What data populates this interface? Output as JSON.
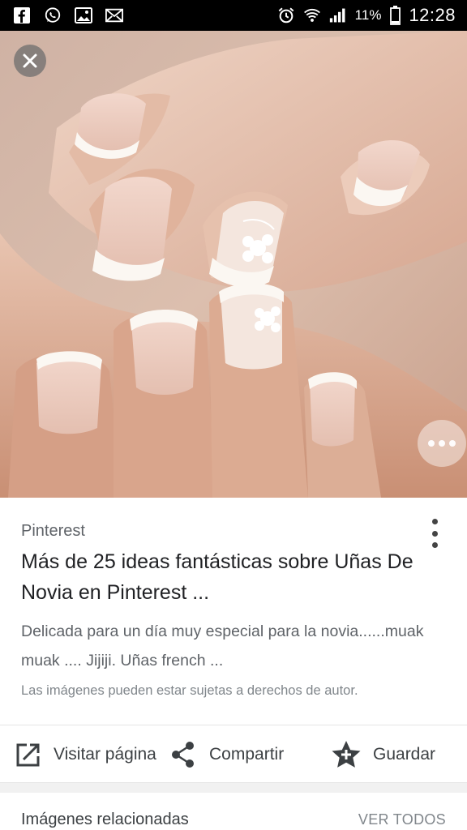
{
  "status_bar": {
    "left_icons": [
      "facebook-icon",
      "whatsapp-icon",
      "gallery-icon",
      "mail-icon"
    ],
    "right_icons": [
      "alarm-icon",
      "wifi-icon",
      "signal-icon",
      "battery-icon"
    ],
    "battery": "11%",
    "time": "12:28"
  },
  "image": {
    "close_icon": "close-icon",
    "more_icon": "more-horizontal-icon"
  },
  "result": {
    "source": "Pinterest",
    "title": "Más de 25 ideas fantásticas sobre Uñas De Novia en Pinterest ...",
    "description": "Delicada para un día muy especial para la novia......muak muak .... Jijiji. Uñas french ...",
    "copyright": "Las imágenes pueden estar sujetas a derechos de autor."
  },
  "actions": {
    "visit": "Visitar página",
    "share": "Compartir",
    "save": "Guardar"
  },
  "related": {
    "title": "Imágenes relacionadas",
    "see_all": "VER TODOS"
  },
  "colors": {
    "status_bar_bg": "#000000",
    "text_primary": "#202124",
    "text_secondary": "#5f6368"
  }
}
